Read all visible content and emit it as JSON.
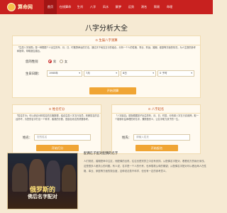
{
  "nav": {
    "logo_text": "算命网",
    "items": [
      "首页",
      "在线算命",
      "生肖",
      "八字",
      "风水",
      "解梦",
      "运势",
      "测名",
      "周易",
      "命理"
    ]
  },
  "page_title": "八字分析大全",
  "bazi": {
    "title": "⊙ 生辰八字测算",
    "desc": "「生辰八字测算」是一种根据个人出生的年、月、日、时推算命运的方法，通过天干地支五行的组合，分析一个人的性格、事业、财运、婚姻、健康等方面的情况，为人生提供参考和指导，帮助趋吉避凶。",
    "gender_label": "您的性别",
    "male": "男",
    "female": "女",
    "birth_label": "生日日期：",
    "year": "1985年",
    "month": "7月",
    "day": "8日",
    "hour": "0 子时",
    "button": "开始测算"
  },
  "left_panel": {
    "title": "⊙ 姓名打分",
    "desc": "「姓名打分」可以综合分析姓名的五格数理，结合生辰八字五行喜忌，判断姓名的吉凶好坏，为您的名字打出一个科学、客观的分数，是起名改名的重要参考。",
    "label": "姓名：",
    "placeholder": "您的姓名",
    "button": "开始打分"
  },
  "right_panel": {
    "title": "⊙ 八字起名",
    "desc": "「八字起名」是指根据孩子出生的年、月、日、时辰，分析其八字五行喜用神，取一个能够补益命理的好名字，兼顾音形义，让名字助力孩子的一生。",
    "label": "姓氏：",
    "placeholder": "请输入姓氏",
    "button": "开始起名"
  },
  "article": {
    "title": "配偶在子配对配偶的名字",
    "image_lines": [
      "俄罗斯的",
      "佛后名字配对"
    ],
    "body": "人们常说，婚姻是命中注定，而配偶的出现，往往也是冥冥之中自有安排。从配偶名字配对，看看双方的缘分深浅，这是很多人都关心的问题。有人说，名字是一个人的代号，也承载着父母的期望；从配偶名字配对可以看出两人在性格、事业、家庭等方面的契合度，这种说法虽不科学，但也有一定的参考意义。"
  },
  "colors": {
    "nav": "#c8211f",
    "button": "#f0a534",
    "background": "#f6ead3"
  }
}
